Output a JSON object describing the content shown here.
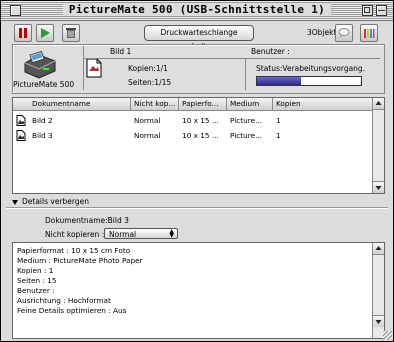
{
  "window": {
    "title": "PictureMate 500 (USB-Schnittstelle 1)"
  },
  "toolbar": {
    "pause_icon": "pause-icon",
    "play_icon": "play-icon",
    "trash_icon": "trash-icon",
    "pause_queue_label": "Druckwarteschlange anhalten",
    "object_count": "3Objekte",
    "balloon_icon": "speech-balloon-icon",
    "ink_icon": "ink-cartridges-icon"
  },
  "printer": {
    "name": "PictureMate 500"
  },
  "job": {
    "name": "Bild 1",
    "copies": "Kopien:1/1",
    "pages": "Seiten:1/15",
    "user_label": "Benutzer :",
    "status": "Status:Verabeitungsvorgang.",
    "progress": 0.42
  },
  "queue": {
    "columns": [
      "Dokumentname",
      "Nicht kop...",
      "Papierfo...",
      "Medium",
      "Kopien"
    ],
    "rows": [
      {
        "name": "Bild 2",
        "mode": "Normal",
        "paper": "10 x 15 ...",
        "medium": "Picture...",
        "copies": "1"
      },
      {
        "name": "Bild 3",
        "mode": "Normal",
        "paper": "10 x 15 ...",
        "medium": "Picture...",
        "copies": "1"
      }
    ]
  },
  "details": {
    "toggle_label": "Details verbergen",
    "doc_name": "Dokumentname:Bild 3",
    "no_copy_label": "Nicht kopieren :",
    "no_copy_value": "Normal",
    "lines": [
      "Papierformat : 10 x 15 cm Foto",
      "Medium : PictureMate Photo Paper",
      "Kopien : 1",
      "Seiten : 15",
      "Benutzer :",
      "Ausrichtung : Hochformat",
      "Feine Details optimieren : Aus"
    ]
  },
  "colors": {
    "progress": "#2a2a8a",
    "pause": "#c00000",
    "play": "#2aa02a"
  }
}
